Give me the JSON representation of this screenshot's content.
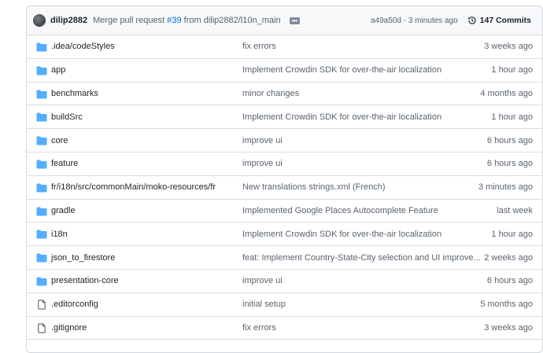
{
  "header": {
    "author": "dilip2882",
    "message_prefix": "Merge pull request ",
    "pr_number": "#39",
    "message_suffix": " from dilip2882/l10n_main",
    "commit_hash": "a49a50d",
    "separator": " · ",
    "commit_time": "3 minutes ago",
    "commits_count": "147 Commits",
    "avatar_icon": "user-avatar",
    "history_icon": "history-icon",
    "more_icon": "ellipsis-icon"
  },
  "colors": {
    "folder": "#54aeff",
    "file_icon": "#59636e",
    "link": "#0969da"
  },
  "files": [
    {
      "name": ".idea/codeStyles",
      "type": "folder",
      "message": "fix errors",
      "age": "3 weeks ago"
    },
    {
      "name": "app",
      "type": "folder",
      "message": "Implement Crowdin SDK for over-the-air localization",
      "age": "1 hour ago"
    },
    {
      "name": "benchmarks",
      "type": "folder",
      "message": "minor changes",
      "age": "4 months ago"
    },
    {
      "name": "buildSrc",
      "type": "folder",
      "message": "Implement Crowdin SDK for over-the-air localization",
      "age": "1 hour ago"
    },
    {
      "name": "core",
      "type": "folder",
      "message": "improve ui",
      "age": "6 hours ago"
    },
    {
      "name": "feature",
      "type": "folder",
      "message": "improve ui",
      "age": "6 hours ago"
    },
    {
      "name": "fr/i18n/src/commonMain/moko-resources/fr",
      "type": "folder",
      "message": "New translations strings.xml (French)",
      "age": "3 minutes ago"
    },
    {
      "name": "gradle",
      "type": "folder",
      "message": "Implemented Google Places Autocomplete Feature",
      "age": "last week"
    },
    {
      "name": "i18n",
      "type": "folder",
      "message": "Implement Crowdin SDK for over-the-air localization",
      "age": "1 hour ago"
    },
    {
      "name": "json_to_firestore",
      "type": "folder",
      "message": "feat: Implement Country-State-City selection and UI improve...",
      "age": "2 weeks ago"
    },
    {
      "name": "presentation-core",
      "type": "folder",
      "message": "improve ui",
      "age": "6 hours ago"
    },
    {
      "name": ".editorconfig",
      "type": "file",
      "message": "initial setup",
      "age": "5 months ago"
    },
    {
      "name": ".gitignore",
      "type": "file",
      "message": "fix errors",
      "age": "3 weeks ago"
    }
  ]
}
